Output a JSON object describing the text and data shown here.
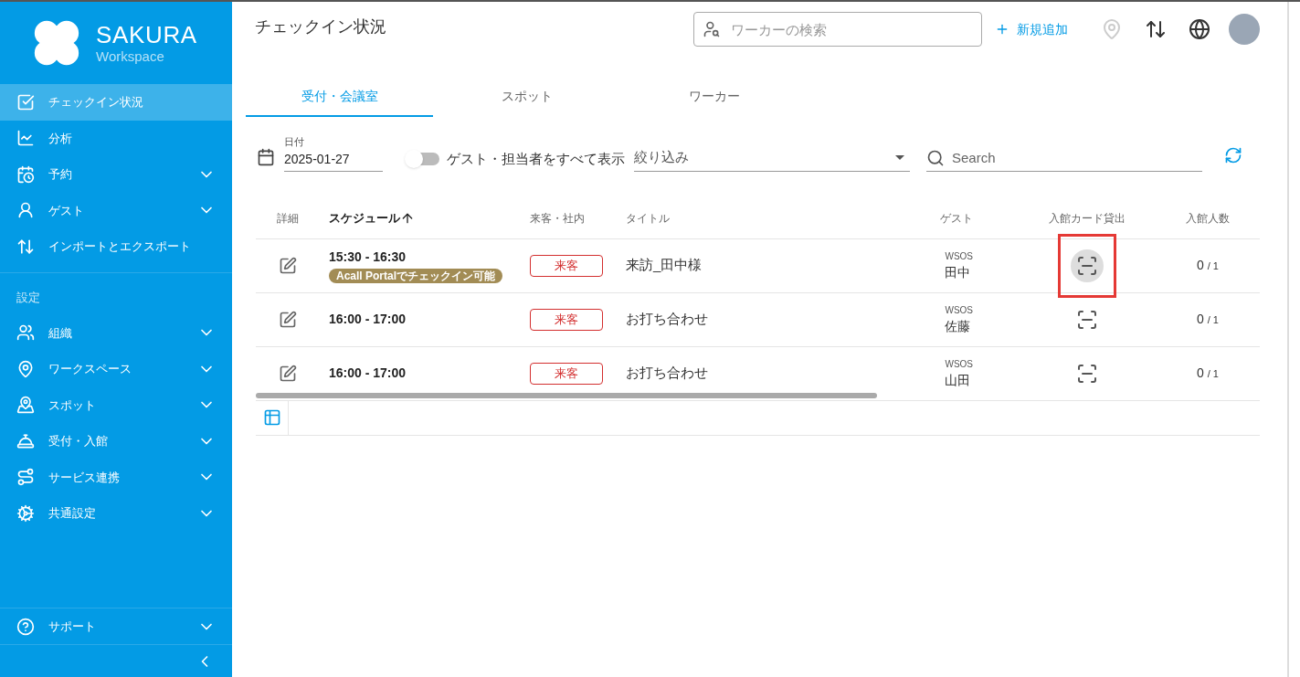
{
  "sidebar": {
    "logo": {
      "title": "SAKURA",
      "subtitle": "Workspace"
    },
    "items": [
      {
        "kind": "item",
        "label": "チェックイン状況",
        "selected": true,
        "expandable": false
      },
      {
        "kind": "item",
        "label": "分析",
        "selected": false,
        "expandable": false
      },
      {
        "kind": "item",
        "label": "予約",
        "selected": false,
        "expandable": true
      },
      {
        "kind": "item",
        "label": "ゲスト",
        "selected": false,
        "expandable": true
      },
      {
        "kind": "item",
        "label": "インポートとエクスポート",
        "selected": false,
        "expandable": false
      },
      {
        "kind": "section",
        "label": "設定"
      },
      {
        "kind": "item",
        "label": "組織",
        "selected": false,
        "expandable": true
      },
      {
        "kind": "item",
        "label": "ワークスペース",
        "selected": false,
        "expandable": true
      },
      {
        "kind": "item",
        "label": "スポット",
        "selected": false,
        "expandable": true
      },
      {
        "kind": "item",
        "label": "受付・入館",
        "selected": false,
        "expandable": true
      },
      {
        "kind": "item",
        "label": "サービス連携",
        "selected": false,
        "expandable": true
      },
      {
        "kind": "item",
        "label": "共通設定",
        "selected": false,
        "expandable": true
      }
    ],
    "support": {
      "label": "サポート",
      "expandable": true
    }
  },
  "header": {
    "title": "チェックイン状況",
    "search": {
      "placeholder": "ワーカーの検索"
    },
    "add_button": "新規追加"
  },
  "tabs": [
    {
      "label": "受付・会議室",
      "selected": true
    },
    {
      "label": "スポット",
      "selected": false
    },
    {
      "label": "ワーカー",
      "selected": false
    }
  ],
  "filters": {
    "date": {
      "label": "日付",
      "value": "2025-01-27"
    },
    "toggle": {
      "label": "ゲスト・担当者をすべて表示",
      "on": false
    },
    "filter_select": {
      "placeholder": "絞り込み"
    },
    "search": {
      "placeholder": "Search"
    }
  },
  "table": {
    "columns": [
      {
        "label": "詳細",
        "sorted": false
      },
      {
        "label": "スケジュール",
        "sorted": true
      },
      {
        "label": "来客・社内",
        "sorted": false
      },
      {
        "label": "タイトル",
        "sorted": false
      },
      {
        "label": "ゲスト",
        "sorted": false
      },
      {
        "label": "入館カード貸出",
        "sorted": false
      },
      {
        "label": "入館人数",
        "sorted": false
      }
    ],
    "rows": [
      {
        "time": "15:30 - 16:30",
        "badge": "Acall Portalでチェックイン可能",
        "type": "来客",
        "title": "来訪_田中様",
        "guest_company": "WSOS",
        "guest_name": "田中",
        "card_hovered": true,
        "highlighted": true,
        "count": "0",
        "capacity": "/ 1"
      },
      {
        "time": "16:00 - 17:00",
        "type": "来客",
        "title": "お打ち合わせ",
        "guest_company": "WSOS",
        "guest_name": "佐藤",
        "card_hovered": false,
        "highlighted": false,
        "count": "0",
        "capacity": "/ 1"
      },
      {
        "time": "16:00 - 17:00",
        "type": "来客",
        "title": "お打ち合わせ",
        "guest_company": "WSOS",
        "guest_name": "山田",
        "card_hovered": false,
        "highlighted": false,
        "count": "0",
        "capacity": "/ 1"
      }
    ]
  }
}
